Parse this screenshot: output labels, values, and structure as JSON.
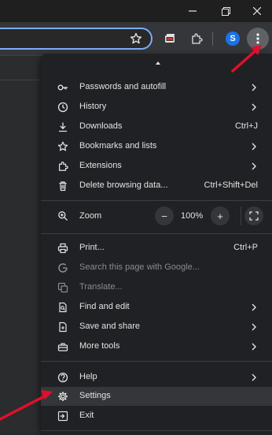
{
  "colors": {
    "accent": "#7cacf8",
    "annotation": "#e0102a",
    "avatar": "#1a73e8"
  },
  "toolbar": {
    "avatar_letter": "S"
  },
  "menu": {
    "items": [
      {
        "label": "Passwords and autofill",
        "icon": "key-icon",
        "submenu": true
      },
      {
        "label": "History",
        "icon": "history-icon",
        "submenu": true
      },
      {
        "label": "Downloads",
        "icon": "download-icon",
        "shortcut": "Ctrl+J"
      },
      {
        "label": "Bookmarks and lists",
        "icon": "star-icon",
        "submenu": true
      },
      {
        "label": "Extensions",
        "icon": "puzzle-icon",
        "submenu": true
      },
      {
        "label": "Delete browsing data...",
        "icon": "trash-icon",
        "shortcut": "Ctrl+Shift+Del"
      },
      {
        "label": "Zoom",
        "icon": "zoom-icon"
      },
      {
        "label": "Print...",
        "icon": "printer-icon",
        "shortcut": "Ctrl+P"
      },
      {
        "label": "Search this page with Google...",
        "icon": "google-icon",
        "disabled": true
      },
      {
        "label": "Translate...",
        "icon": "translate-icon",
        "disabled": true
      },
      {
        "label": "Find and edit",
        "icon": "find-icon",
        "submenu": true
      },
      {
        "label": "Save and share",
        "icon": "save-share-icon",
        "submenu": true
      },
      {
        "label": "More tools",
        "icon": "toolbox-icon",
        "submenu": true
      },
      {
        "label": "Help",
        "icon": "help-icon",
        "submenu": true
      },
      {
        "label": "Settings",
        "icon": "gear-icon",
        "highlighted": true
      },
      {
        "label": "Exit",
        "icon": "exit-icon"
      }
    ],
    "zoom": {
      "minus": "−",
      "value": "100%",
      "plus": "+"
    }
  }
}
